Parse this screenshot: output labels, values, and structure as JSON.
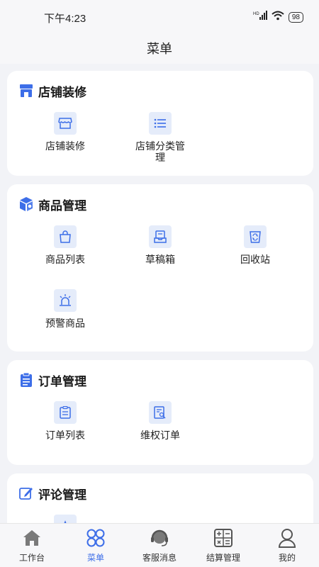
{
  "status_bar": {
    "time": "下午4:23",
    "battery": "98"
  },
  "nav": {
    "title": "菜单"
  },
  "sections": [
    {
      "title": "店铺装修",
      "items": [
        {
          "label": "店铺装修",
          "icon": "storefront-icon"
        },
        {
          "label": "店铺分类管理",
          "icon": "list-icon"
        }
      ]
    },
    {
      "title": "商品管理",
      "items": [
        {
          "label": "商品列表",
          "icon": "shopping-bag-icon"
        },
        {
          "label": "草稿箱",
          "icon": "draft-box-icon"
        },
        {
          "label": "回收站",
          "icon": "recycle-bin-icon"
        },
        {
          "label": "预警商品",
          "icon": "alarm-light-icon"
        }
      ]
    },
    {
      "title": "订单管理",
      "items": [
        {
          "label": "订单列表",
          "icon": "clipboard-icon"
        },
        {
          "label": "维权订单",
          "icon": "document-search-icon"
        }
      ]
    },
    {
      "title": "评论管理",
      "items": []
    }
  ],
  "tabs": [
    {
      "label": "工作台",
      "icon": "home-icon",
      "active": false
    },
    {
      "label": "菜单",
      "icon": "menu-grid-icon",
      "active": true
    },
    {
      "label": "客服消息",
      "icon": "headset-icon",
      "active": false
    },
    {
      "label": "结算管理",
      "icon": "calculator-icon",
      "active": false
    },
    {
      "label": "我的",
      "icon": "user-icon",
      "active": false
    }
  ],
  "colors": {
    "accent": "#3d6ee8",
    "icon_bg": "#e5ecfa",
    "page_bg": "#f2f3f7"
  }
}
